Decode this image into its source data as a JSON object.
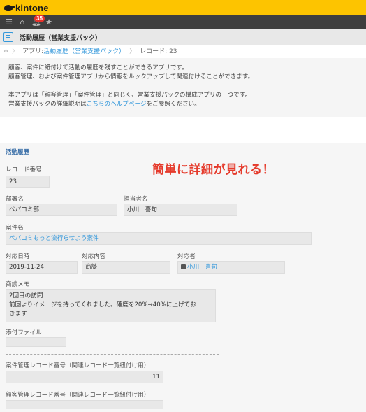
{
  "header": {
    "logo_text": "kintone"
  },
  "nav": {
    "notification_count": "35"
  },
  "app": {
    "title": "活動履歴（営業支援パック）"
  },
  "breadcrumb": {
    "app_prefix": "アプリ: ",
    "app_name": "活動履歴（営業支援パック）",
    "record": "レコード: 23"
  },
  "description": {
    "line1": "顧客、案件に紐付けて活動の履歴を残すことができるアプリです。",
    "line2": "顧客管理、および案件管理アプリから情報をルックアップして関連付けることができます。",
    "line3": "本アプリは「顧客管理」「案件管理」と同じく、営業支援パックの構成アプリの一つです。",
    "line4_pre": "営業支援パックの詳細説明は",
    "line4_link": "こちらのヘルプページ",
    "line4_post": "をご参照ください。"
  },
  "annotation": "簡単に詳細が見れる！",
  "record": {
    "section_title": "活動履歴",
    "record_number": {
      "label": "レコード番号",
      "value": "23"
    },
    "department": {
      "label": "部署名",
      "value": "ペパコミ部"
    },
    "assignee": {
      "label": "担当者名",
      "value": "小川　喜句"
    },
    "case_name": {
      "label": "案件名",
      "value": "ペパコミもっと流行らせよう案件"
    },
    "date": {
      "label": "対応日時",
      "value": "2019-11-24"
    },
    "content": {
      "label": "対応内容",
      "value": "商談"
    },
    "responder": {
      "label": "対応者",
      "value": "小川　喜句"
    },
    "memo": {
      "label": "商談メモ",
      "line1": "2回目の訪問",
      "line2": "前回よりイメージを持ってくれました。確度を20%→40%に上げてお",
      "line3": "きます"
    },
    "attachment": {
      "label": "添付ファイル",
      "value": ""
    },
    "case_record_number": {
      "label": "案件管理レコード番号（関連レコード一覧紐付け用）",
      "value": "11"
    },
    "customer_record_number": {
      "label": "顧客管理レコード番号（関連レコード一覧紐付け用）",
      "value": ""
    }
  },
  "colors": {
    "brand_yellow": "#fdc400",
    "link_blue": "#3498db",
    "annotation_red": "#e53b2c",
    "nav_dark": "#3e3e3e"
  }
}
